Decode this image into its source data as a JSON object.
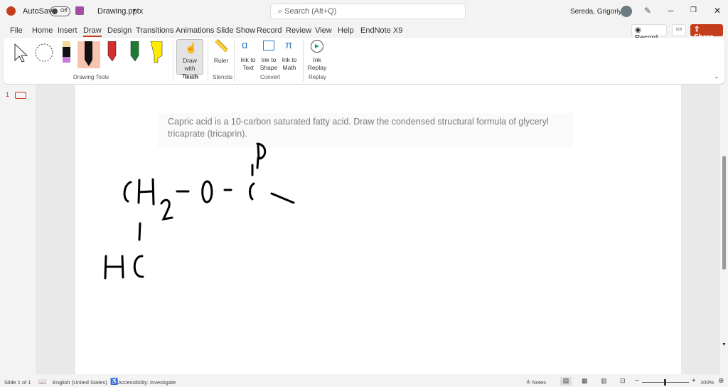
{
  "titlebar": {
    "autosave_label": "AutoSave",
    "toggle_state": "Off",
    "filename": "Drawing.pptx",
    "search_placeholder": "Search (Alt+Q)",
    "user": "Sereda, Grigoriy A"
  },
  "tabs": [
    "File",
    "Home",
    "Insert",
    "Draw",
    "Design",
    "Transitions",
    "Animations",
    "Slide Show",
    "Record",
    "Review",
    "View",
    "Help",
    "EndNote X9"
  ],
  "active_tab": "Draw",
  "actions": {
    "record": "Record",
    "share": "Share"
  },
  "ribbon": {
    "groups": {
      "drawing_tools": "Drawing Tools",
      "touch": "Touch",
      "stencils": "Stencils",
      "convert": "Convert",
      "replay": "Replay"
    },
    "draw_with_touch": "Draw with Touch",
    "ruler": "Ruler",
    "ink_to_text": "Ink to Text",
    "ink_to_shape": "Ink to Shape",
    "ink_to_math": "Ink to Math",
    "ink_replay": "Ink Replay",
    "pen_colors": [
      "#000000",
      "#d32f2f",
      "#1e7b34",
      "#ffeb00"
    ]
  },
  "thumbs": {
    "slide_number": "1"
  },
  "slide": {
    "question": "Capric acid is a 10-carbon saturated fatty acid. Draw the condensed structural formula of glyceryl tricaprate (tricaprin)."
  },
  "status": {
    "slide": "Slide 1 of 1",
    "language": "English (United States)",
    "accessibility": "Accessibility: Investigate",
    "notes": "Notes",
    "zoom": "100%"
  }
}
